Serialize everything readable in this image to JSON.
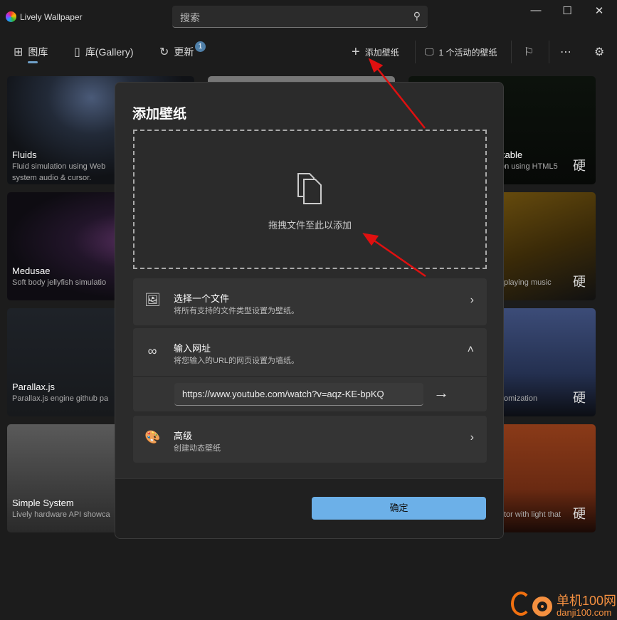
{
  "app": {
    "title": "Lively Wallpaper"
  },
  "search": {
    "placeholder": "搜索"
  },
  "nav": {
    "gallery": "图库",
    "library": "库(Gallery)",
    "update": "更新",
    "update_badge": "1",
    "add_wallpaper": "添加壁纸",
    "active": "1 个活动的壁纸"
  },
  "cards": [
    {
      "title": "Fluids",
      "desc": "Fluid simulation using Web",
      "desc2": "system audio & cursor."
    },
    {
      "title": "Medusae",
      "desc": "Soft body jellyfish simulatio"
    },
    {
      "title": "Parallax.js",
      "desc": "Parallax.js engine github pa"
    },
    {
      "title": "Simple System",
      "desc": "Lively hardware API showca"
    },
    {
      "title": "zable",
      "desc": "on using HTML5",
      "tag": "硬"
    },
    {
      "desc": "playing music",
      "tag": "硬"
    },
    {
      "desc": "omization",
      "tag": "硬"
    },
    {
      "desc": "tor with light that",
      "tag": "硬"
    }
  ],
  "dialog": {
    "title": "添加壁纸",
    "drop_text": "拖拽文件至此以添加",
    "file": {
      "title": "选择一个文件",
      "subtitle": "将所有支持的文件类型设置为壁纸。"
    },
    "url": {
      "title": "输入网址",
      "subtitle": "将您输入的URL的网页设置为墙纸。",
      "value": "https://www.youtube.com/watch?v=aqz-KE-bpKQ"
    },
    "advanced": {
      "title": "高级",
      "subtitle": "创建动态壁纸"
    },
    "ok": "确定"
  },
  "watermark": {
    "cn": "单机100网",
    "url": "danji100.com"
  },
  "colors": {
    "accent": "#6cb0e8",
    "annotation": "#e01010"
  }
}
